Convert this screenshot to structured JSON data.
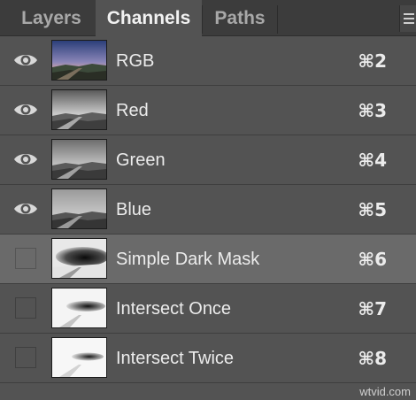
{
  "tabs": [
    {
      "label": "Layers",
      "active": false
    },
    {
      "label": "Channels",
      "active": true
    },
    {
      "label": "Paths",
      "active": false
    }
  ],
  "channels": [
    {
      "name": "RGB",
      "shortcut": "⌘2",
      "visible": true,
      "selected": false,
      "thumbnail": "color-landscape"
    },
    {
      "name": "Red",
      "shortcut": "⌘3",
      "visible": true,
      "selected": false,
      "thumbnail": "grayscale-landscape"
    },
    {
      "name": "Green",
      "shortcut": "⌘4",
      "visible": true,
      "selected": false,
      "thumbnail": "grayscale-landscape"
    },
    {
      "name": "Blue",
      "shortcut": "⌘5",
      "visible": true,
      "selected": false,
      "thumbnail": "grayscale-landscape"
    },
    {
      "name": "Simple Dark Mask",
      "shortcut": "⌘6",
      "visible": false,
      "selected": true,
      "thumbnail": "mask-dark"
    },
    {
      "name": "Intersect Once",
      "shortcut": "⌘7",
      "visible": false,
      "selected": false,
      "thumbnail": "mask-light"
    },
    {
      "name": "Intersect Twice",
      "shortcut": "⌘8",
      "visible": false,
      "selected": false,
      "thumbnail": "mask-lighter"
    }
  ],
  "icons": {
    "visibility": "eye-icon",
    "panel_menu": "menu-icon"
  },
  "watermark": "wtvid.com",
  "colors": {
    "panel_bg": "#535353",
    "selected_row": "#6a6a6a",
    "tabbar_bg": "#3c3c3c"
  }
}
